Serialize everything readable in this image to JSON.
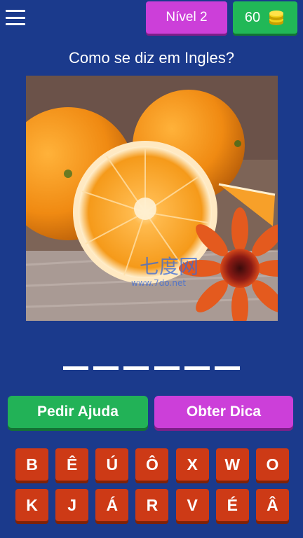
{
  "header": {
    "level_label": "Nível 2",
    "coins": "60",
    "menu_icon": "hamburger-menu-icon",
    "coin_icon": "coin-stack-icon",
    "colors": {
      "level": "#cc3fd9",
      "coins": "#21b857",
      "background": "#1b3a8c"
    }
  },
  "question": {
    "text": "Como se diz em Ingles?"
  },
  "image": {
    "subject": "oranges-and-gerbera-flower",
    "watermark_main": "七度网",
    "watermark_sub": "www.7do.net"
  },
  "answer": {
    "slot_count": 6
  },
  "actions": {
    "help_label": "Pedir Ajuda",
    "hint_label": "Obter Dica"
  },
  "keyboard": {
    "rows": [
      [
        "B",
        "Ê",
        "Ú",
        "Ô",
        "X",
        "W",
        "O"
      ],
      [
        "K",
        "J",
        "Á",
        "R",
        "V",
        "É",
        "Â"
      ]
    ]
  }
}
